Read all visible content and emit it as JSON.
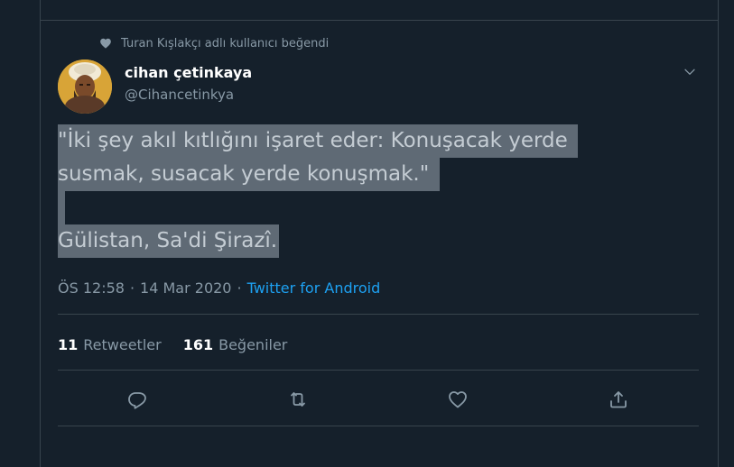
{
  "social_context": {
    "icon": "heart-icon",
    "text": "Turan Kışlakçı adlı kullanıcı beğendi"
  },
  "author": {
    "name": "cihan çetinkaya",
    "handle": "@Cihancetinkya"
  },
  "tweet": {
    "line1": "\"İki şey akıl kıtlığını işaret eder: Konuşacak yerde",
    "line2": "susmak, susacak yerde konuşmak.\"",
    "line4": "Gülistan, Sa'di Şirazî."
  },
  "meta": {
    "time": "ÖS 12:58",
    "date": "14 Mar 2020",
    "separator": "·",
    "source": "Twitter for Android"
  },
  "stats": {
    "retweets_count": "11",
    "retweets_label": "Retweetler",
    "likes_count": "161",
    "likes_label": "Beğeniler"
  },
  "actions": {
    "reply_icon": "reply-icon",
    "retweet_icon": "retweet-icon",
    "like_icon": "heart-icon",
    "share_icon": "share-icon"
  },
  "colors": {
    "background": "#15202b",
    "border": "#38444d",
    "muted": "#8899a6",
    "accent": "#1da1f2",
    "highlight": "#5f6a75"
  }
}
